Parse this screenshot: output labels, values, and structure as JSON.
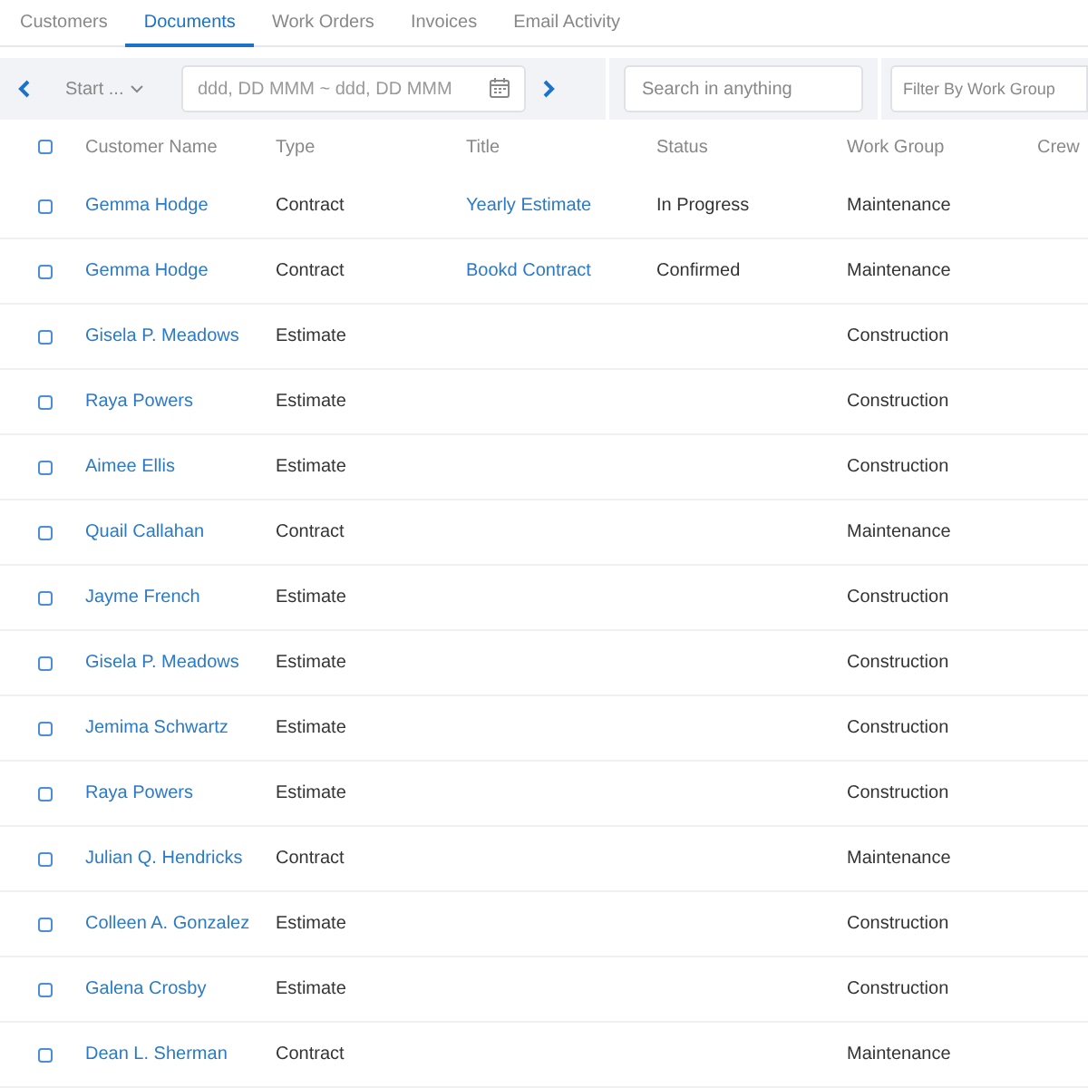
{
  "tabs": [
    {
      "label": "Customers",
      "selected": false
    },
    {
      "label": "Documents",
      "selected": true
    },
    {
      "label": "Work Orders",
      "selected": false
    },
    {
      "label": "Invoices",
      "selected": false
    },
    {
      "label": "Email Activity",
      "selected": false
    }
  ],
  "toolbar": {
    "range_select": "Start ...",
    "date_range": {
      "placeholder": "ddd, DD MMM ~ ddd, DD MMM"
    },
    "search": {
      "placeholder": "Search in anything"
    },
    "work_group_filter": {
      "placeholder": "Filter By Work Group"
    }
  },
  "table": {
    "select_all_checked": false,
    "columns": [
      "Customer Name",
      "Type",
      "Title",
      "Status",
      "Work Group",
      "Crew"
    ],
    "rows": [
      {
        "checked": false,
        "customer": "Gemma Hodge",
        "type": "Contract",
        "title": "Yearly Estimate",
        "status": "In Progress",
        "work_group": "Maintenance"
      },
      {
        "checked": false,
        "customer": "Gemma Hodge",
        "type": "Contract",
        "title": "Bookd Contract",
        "status": "Confirmed",
        "work_group": "Maintenance"
      },
      {
        "checked": false,
        "customer": "Gisela P. Meadows",
        "type": "Estimate",
        "work_group": "Construction"
      },
      {
        "checked": false,
        "customer": "Raya Powers",
        "type": "Estimate",
        "work_group": "Construction"
      },
      {
        "checked": false,
        "customer": "Aimee Ellis",
        "type": "Estimate",
        "work_group": "Construction"
      },
      {
        "checked": false,
        "customer": "Quail Callahan",
        "type": "Contract",
        "work_group": "Maintenance"
      },
      {
        "checked": false,
        "customer": "Jayme French",
        "type": "Estimate",
        "work_group": "Construction"
      },
      {
        "checked": false,
        "customer": "Gisela P. Meadows",
        "type": "Estimate",
        "work_group": "Construction"
      },
      {
        "checked": false,
        "customer": "Jemima Schwartz",
        "type": "Estimate",
        "work_group": "Construction"
      },
      {
        "checked": false,
        "customer": "Raya Powers",
        "type": "Estimate",
        "work_group": "Construction"
      },
      {
        "checked": false,
        "customer": "Julian Q. Hendricks",
        "type": "Contract",
        "work_group": "Maintenance"
      },
      {
        "checked": false,
        "customer": "Colleen A. Gonzalez",
        "type": "Estimate",
        "work_group": "Construction"
      },
      {
        "checked": false,
        "customer": "Galena Crosby",
        "type": "Estimate",
        "work_group": "Construction"
      },
      {
        "checked": false,
        "customer": "Dean L. Sherman",
        "type": "Contract",
        "work_group": "Maintenance"
      }
    ]
  }
}
